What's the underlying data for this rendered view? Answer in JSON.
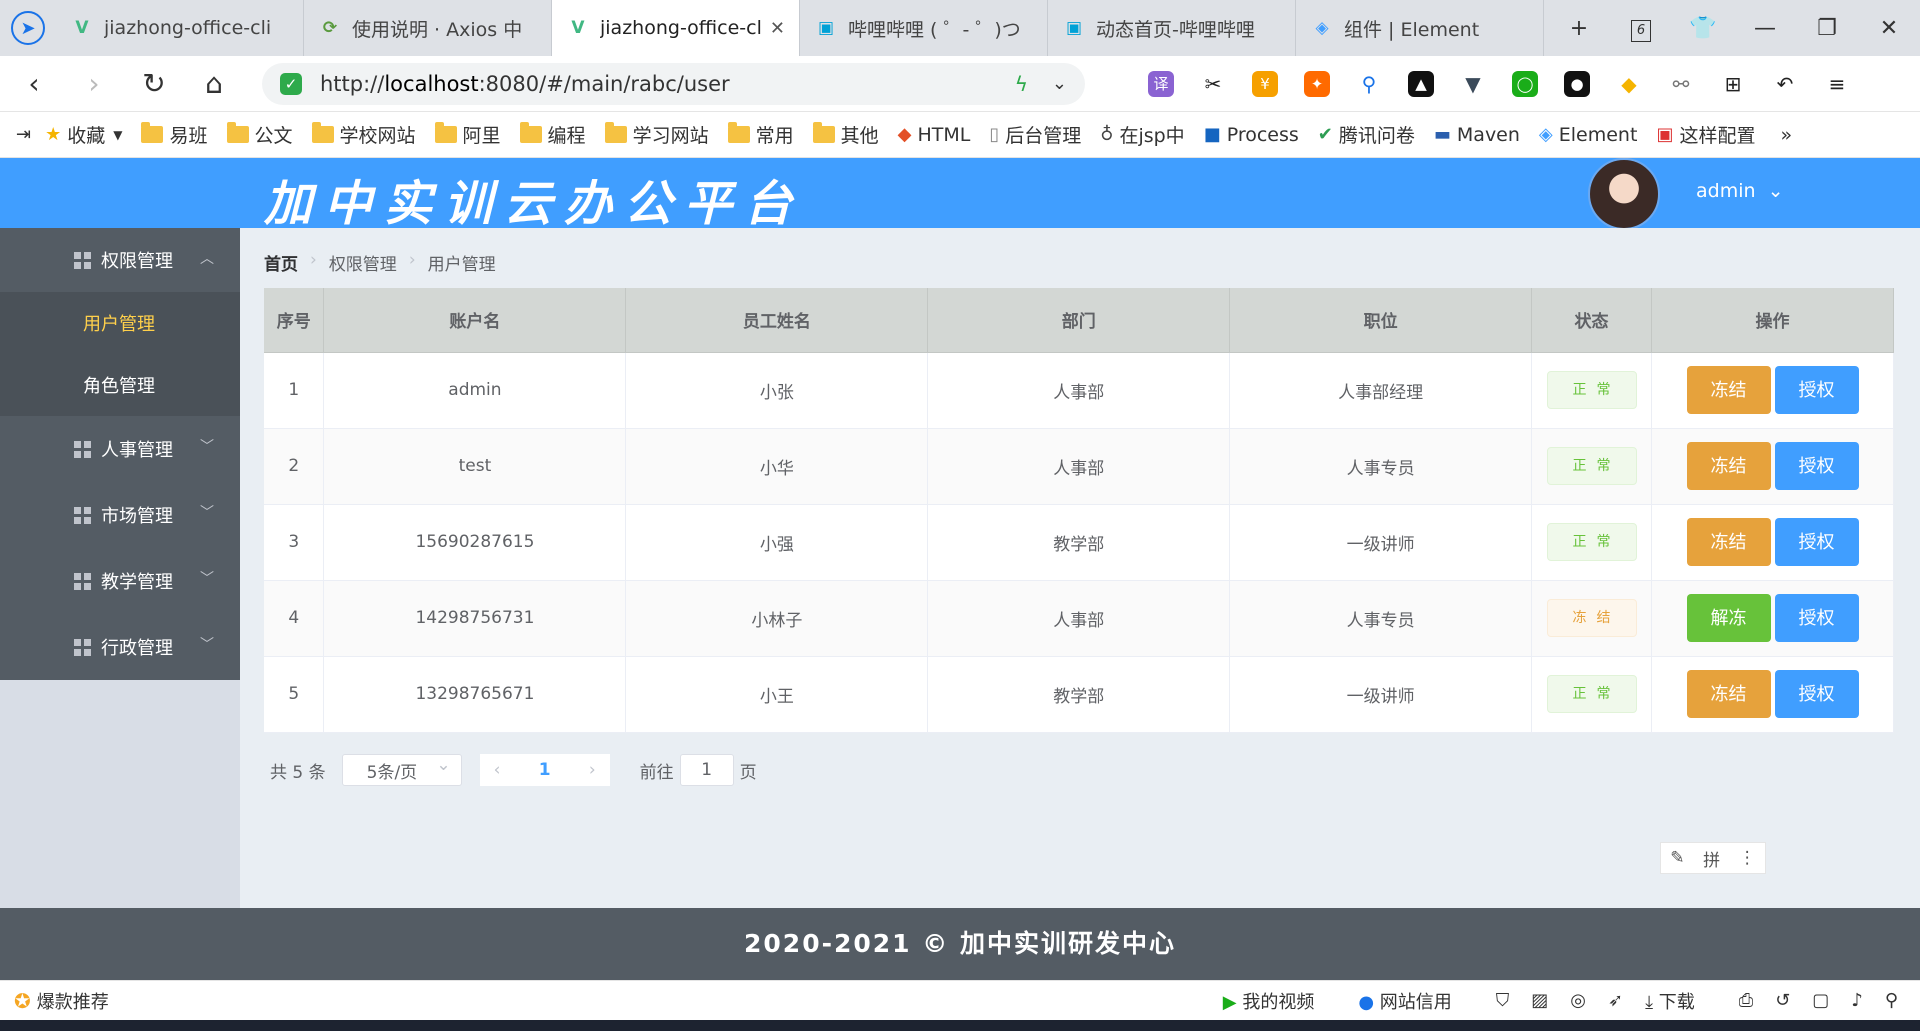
{
  "browser": {
    "tabs": [
      {
        "title": "jiazhong-office-cli",
        "icon": "V",
        "color": "#41b883",
        "active": false
      },
      {
        "title": "使用说明 · Axios 中",
        "icon": "⟳",
        "color": "#5a9a3f",
        "active": false
      },
      {
        "title": "jiazhong-office-cli",
        "icon": "V",
        "color": "#41b883",
        "active": true
      },
      {
        "title": "哔哩哔哩 ( ゜- ゜)つ",
        "icon": "▣",
        "color": "#00a1d6",
        "active": false
      },
      {
        "title": "动态首页-哔哩哔哩",
        "icon": "▣",
        "color": "#00a1d6",
        "active": false
      },
      {
        "title": "组件 | Element",
        "icon": "◈",
        "color": "#409eff",
        "active": false
      }
    ],
    "tab_count": "6",
    "url_prefix": "http://",
    "url_host": "localhost",
    "url_rest": ":8080/#/main/rabc/user",
    "bookmarks": [
      {
        "label": "收藏",
        "kind": "star"
      },
      {
        "label": "易班",
        "kind": "folder"
      },
      {
        "label": "公文",
        "kind": "folder"
      },
      {
        "label": "学校网站",
        "kind": "folder"
      },
      {
        "label": "阿里",
        "kind": "folder"
      },
      {
        "label": "编程",
        "kind": "folder"
      },
      {
        "label": "学习网站",
        "kind": "folder"
      },
      {
        "label": "常用",
        "kind": "folder"
      },
      {
        "label": "其他",
        "kind": "folder"
      },
      {
        "label": "HTML",
        "kind": "html5"
      },
      {
        "label": "后台管理",
        "kind": "page"
      },
      {
        "label": "在jsp中",
        "kind": "mask"
      },
      {
        "label": "Process",
        "kind": "on"
      },
      {
        "label": "腾讯问卷",
        "kind": "check"
      },
      {
        "label": "Maven",
        "kind": "mvn"
      },
      {
        "label": "Element",
        "kind": "element"
      },
      {
        "label": "这样配置",
        "kind": "red"
      }
    ]
  },
  "app": {
    "logo": "加中实训云办公平台",
    "user": "admin",
    "menu": [
      {
        "label": "权限管理",
        "open": true,
        "children": [
          {
            "label": "用户管理",
            "active": true
          },
          {
            "label": "角色管理",
            "active": false
          }
        ]
      },
      {
        "label": "人事管理",
        "open": false,
        "children": []
      },
      {
        "label": "市场管理",
        "open": false,
        "children": []
      },
      {
        "label": "教学管理",
        "open": false,
        "children": []
      },
      {
        "label": "行政管理",
        "open": false,
        "children": []
      }
    ],
    "breadcrumb": [
      "首页",
      "权限管理",
      "用户管理"
    ],
    "table": {
      "headers": [
        "序号",
        "账户名",
        "员工姓名",
        "部门",
        "职位",
        "状态",
        "操作"
      ],
      "rows": [
        {
          "no": "1",
          "account": "admin",
          "name": "小张",
          "dept": "人事部",
          "position": "人事部经理",
          "status": "正常",
          "frozen": false,
          "toggle": "冻结",
          "auth": "授权"
        },
        {
          "no": "2",
          "account": "test",
          "name": "小华",
          "dept": "人事部",
          "position": "人事专员",
          "status": "正常",
          "frozen": false,
          "toggle": "冻结",
          "auth": "授权"
        },
        {
          "no": "3",
          "account": "15690287615",
          "name": "小强",
          "dept": "教学部",
          "position": "一级讲师",
          "status": "正常",
          "frozen": false,
          "toggle": "冻结",
          "auth": "授权"
        },
        {
          "no": "4",
          "account": "14298756731",
          "name": "小林子",
          "dept": "人事部",
          "position": "人事专员",
          "status": "冻结",
          "frozen": true,
          "toggle": "解冻",
          "auth": "授权"
        },
        {
          "no": "5",
          "account": "13298765671",
          "name": "小王",
          "dept": "教学部",
          "position": "一级讲师",
          "status": "正常",
          "frozen": false,
          "toggle": "冻结",
          "auth": "授权"
        }
      ]
    },
    "pager": {
      "total": "共 5 条",
      "page_size": "5条/页",
      "current": "1",
      "goto_label": "前往",
      "goto_value": "1",
      "page_unit": "页"
    },
    "ime_label": "拼",
    "footer": "2020-2021 © 加中实训研发中心"
  },
  "statusbar": {
    "promo": "爆款推荐",
    "video": "我的视频",
    "credit": "网站信用",
    "download": "下载"
  },
  "colors": {
    "primary": "#409eff",
    "success": "#67c23a",
    "warning": "#e6a23c",
    "menu_bg": "#545c64",
    "menu_active": "#ffd04b"
  }
}
